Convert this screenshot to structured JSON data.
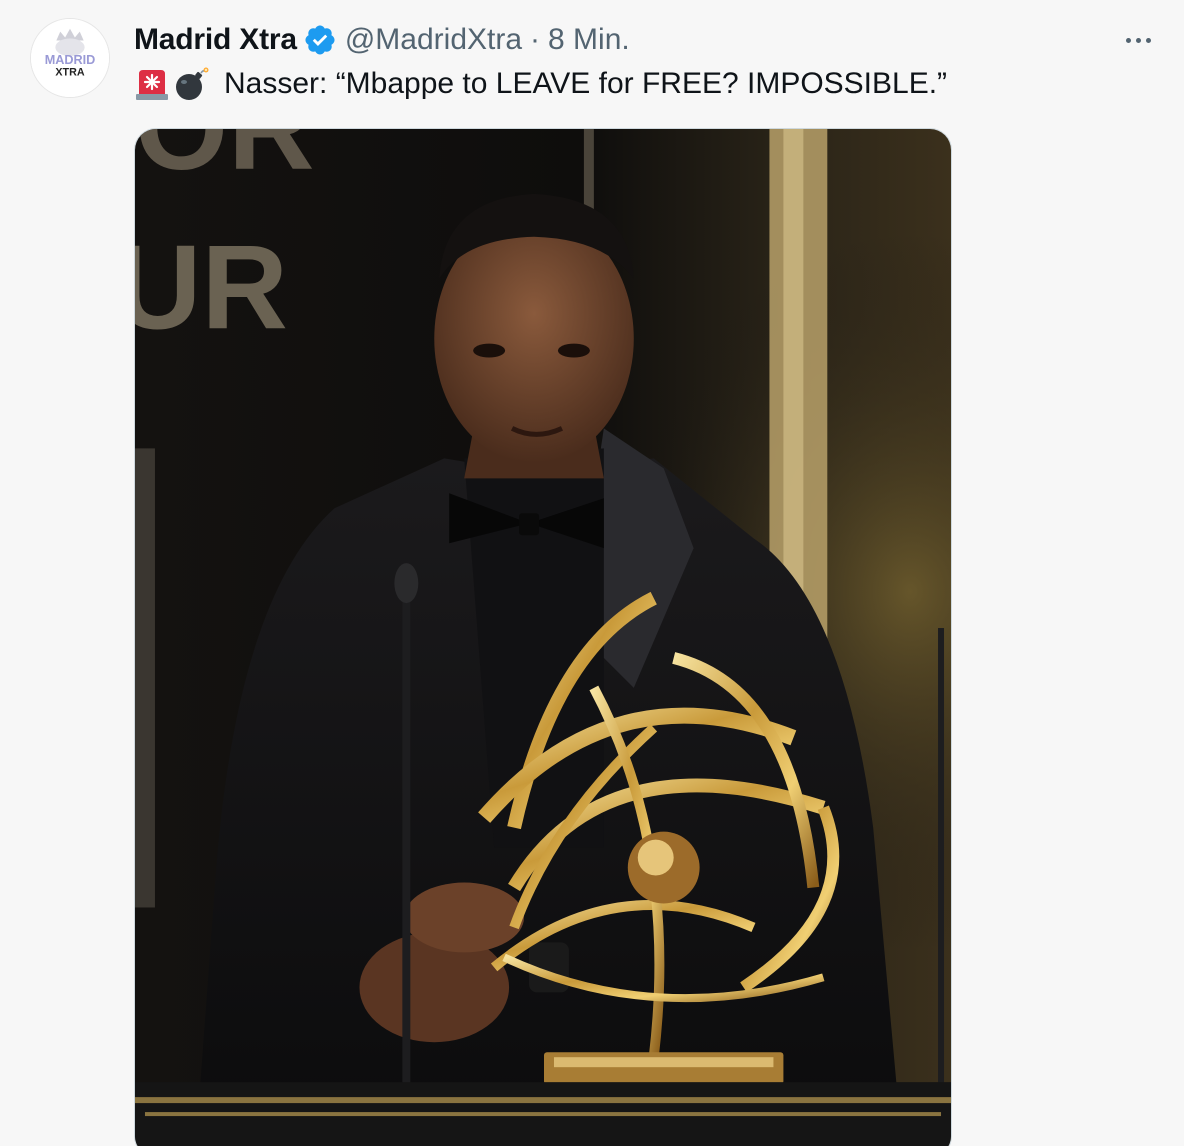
{
  "tweet": {
    "author": {
      "display_name": "Madrid Xtra",
      "handle": "@MadridXtra",
      "avatar_text": [
        "MADRID",
        "XTRA"
      ],
      "avatar_icon": "crown-logo",
      "verified_icon": "verified-badge-icon"
    },
    "separator": "·",
    "time": "8 Min.",
    "more_icon": "more-horizontal-icon",
    "emojis": [
      "rotating-light-emoji",
      "bomb-emoji"
    ],
    "text": "Nasser: “Mbappe to LEAVE for FREE? IMPOSSIBLE.”",
    "media": {
      "type": "photo",
      "backdrop_letters": [
        "OR",
        "UR"
      ]
    },
    "colors": {
      "verified": "#1d9bf0",
      "secondary_text": "#536471",
      "primary_text": "#0f1419",
      "background": "#f7f7f7"
    }
  }
}
